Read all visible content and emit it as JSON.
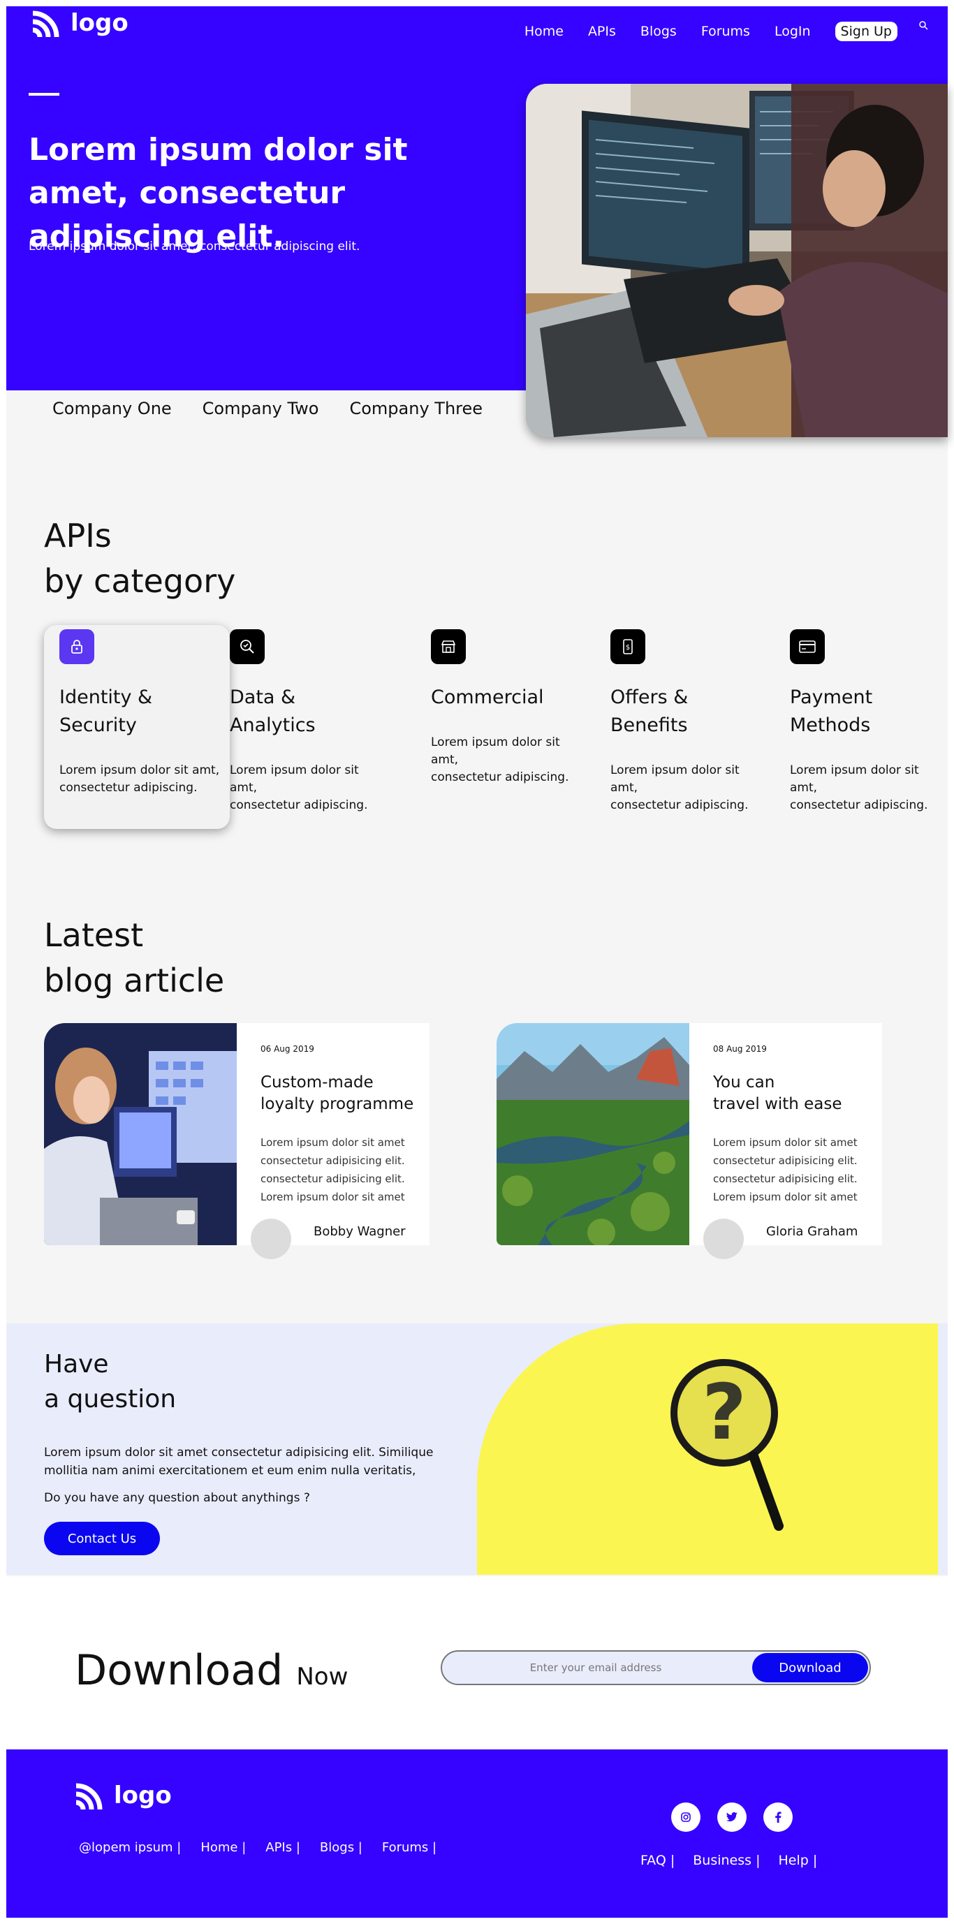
{
  "header": {
    "logo_text": "logo",
    "nav": [
      "Home",
      "APIs",
      "Blogs",
      "Forums",
      "LogIn"
    ],
    "signup_label": "Sign Up",
    "search_icon": "search-icon"
  },
  "hero": {
    "title": "Lorem ipsum dolor sit amet, consectetur adipiscing elit.",
    "subtitle": "Lorem ipsum dolor sit amet, consectetur adipiscing elit.",
    "image": "developer-at-monitors-photo"
  },
  "companies": [
    "Company One",
    "Company Two",
    "Company Three"
  ],
  "apis": {
    "title_line1": "APIs",
    "title_line2": "by category",
    "cards": [
      {
        "icon": "lock-icon",
        "title_l1": "Identity &",
        "title_l2": "Security",
        "desc_l1": "Lorem ipsum dolor sit amt,",
        "desc_l2": "consectetur adipiscing."
      },
      {
        "icon": "magnifier-check-icon",
        "title_l1": "Data &",
        "title_l2": "Analytics",
        "desc_l1": "Lorem ipsum dolor sit",
        "desc_l2": "amt,",
        "desc_l3": "consectetur adipiscing."
      },
      {
        "icon": "store-icon",
        "title_l1": "Commercial",
        "desc_l1": "Lorem ipsum dolor sit",
        "desc_l2": "amt,",
        "desc_l3": "consectetur adipiscing."
      },
      {
        "icon": "phone-dollar-icon",
        "title_l1": "Offers &",
        "title_l2": "Benefits",
        "desc_l1": "Lorem ipsum dolor sit",
        "desc_l2": "amt,",
        "desc_l3": "consectetur adipiscing."
      },
      {
        "icon": "credit-card-icon",
        "title_l1": "Payment",
        "title_l2": "Methods",
        "desc_l1": "Lorem ipsum dolor sit",
        "desc_l2": "amt,",
        "desc_l3": "consectetur adipiscing."
      }
    ]
  },
  "blog": {
    "title_line1": "Latest",
    "title_line2": "blog article",
    "articles": [
      {
        "date": "06 Aug 2019",
        "title_l1": "Custom-made",
        "title_l2": "loyalty programme",
        "text": [
          "Lorem ipsum dolor sit amet",
          "consectetur adipisicing elit.",
          "consectetur adipisicing elit.",
          "Lorem ipsum dolor sit amet"
        ],
        "author": "Bobby Wagner",
        "image": "woman-at-computer-photo"
      },
      {
        "date": "08 Aug 2019",
        "title_l1": "You can",
        "title_l2": "travel with ease",
        "text": [
          "Lorem ipsum dolor sit amet",
          "consectetur adipisicing elit.",
          "consectetur adipisicing elit.",
          "Lorem ipsum dolor sit amet"
        ],
        "author": "Gloria Graham",
        "image": "river-landscape-photo"
      }
    ]
  },
  "question": {
    "title_l1": "Have",
    "title_l2": "a question",
    "text": "Lorem ipsum dolor sit amet consectetur adipisicing elit. Similique mollitia nam animi exercitationem et eum enim nulla veritatis,",
    "prompt": "Do you have any question about anythings ?",
    "button": "Contact Us",
    "image": "magnifier-question-mark-photo"
  },
  "download": {
    "title": "Download",
    "title_small": "Now",
    "placeholder": "Enter your email address",
    "button": "Download"
  },
  "footer": {
    "logo_text": "logo",
    "links": [
      "@lopem ipsum |",
      "Home |",
      "APIs |",
      "Blogs |",
      "Forums |"
    ],
    "social": [
      "instagram-icon",
      "twitter-icon",
      "facebook-icon"
    ],
    "links2": [
      "FAQ |",
      "Business |",
      "Help |"
    ]
  },
  "colors": {
    "brand": "#3503ff",
    "button": "#0a07f0",
    "highlight": "#fbf552",
    "light": "#e9ecfb"
  }
}
